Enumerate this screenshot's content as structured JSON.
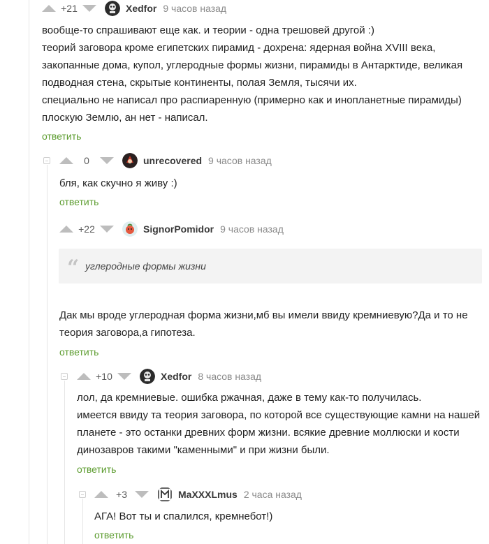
{
  "comments": [
    {
      "rating": "+21",
      "author": "Xedfor",
      "time": "9 часов назад",
      "lines": [
        "вообще-то спрашивают еще как. и теории - одна трешовей другой :)",
        "теорий заговора кроме египетских пирамид - дохрена: ядерная война XVIII века,",
        "закопанные дома, купол, углеродные формы жизни, пирамиды в Антарктиде, великая",
        "подводная стена, скрытые континенты, полая Земля, тысячи их.",
        "специально не написал про распиаренную (примерно как и инопланетные пирамиды)",
        "плоскую Землю, ан нет - написал."
      ],
      "reply": "ответить"
    },
    {
      "rating": "0",
      "author": "unrecovered",
      "time": "9 часов назад",
      "lines": [
        "бля, как скучно я живу :)"
      ],
      "reply": "ответить"
    },
    {
      "rating": "+22",
      "author": "SignorPomidor",
      "time": "9 часов назад",
      "quote": "углеродные формы жизни",
      "lines": [
        "Дак мы вроде углеродная форма жизни,мб вы имели ввиду кремниевую?Да и то не",
        "теория заговора,а гипотеза."
      ],
      "reply": "ответить"
    },
    {
      "rating": "+10",
      "author": "Xedfor",
      "time": "8 часов назад",
      "lines": [
        "лол, да кремниевые. ошибка ржачная, даже в тему как-то получилась.",
        "имеется ввиду та теория заговора, по которой все существующие камни на нашей",
        "планете - это останки древних форм жизни. всякие древние моллюски и кости",
        "динозавров такими \"каменными\" и при жизни были."
      ],
      "reply": "ответить"
    },
    {
      "rating": "+3",
      "author": "MaXXXLmus",
      "time": "2 часа назад",
      "lines": [
        "АГА! Вот ты и спалился, кремнебот!)"
      ],
      "reply": "ответить"
    }
  ],
  "icons": {
    "upvote": "arrow-up-icon",
    "downvote": "arrow-down-icon",
    "collapse": "collapse-thread-icon",
    "quote": "quote-icon"
  },
  "colors": {
    "reply_link": "#5c9c2f",
    "arrows": "#bdbdbd",
    "quote_bg": "#f3f3f3",
    "rails": "#e6e6e6"
  }
}
